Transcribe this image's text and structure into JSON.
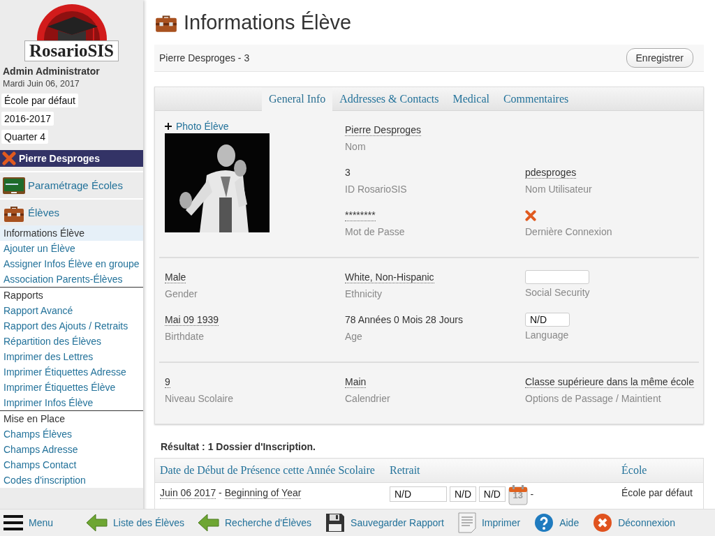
{
  "sidebar": {
    "logo": "RosarioSIS",
    "user": "Admin Administrator",
    "date": "Mardi Juin 06, 2017",
    "selectors": [
      "École par défaut",
      "2016-2017",
      "Quarter 4"
    ],
    "current_student": "Pierre Desproges",
    "modules": [
      {
        "label": "Paramétrage Écoles"
      },
      {
        "label": "Élèves",
        "items": [
          {
            "kind": "link",
            "label": "Informations Élève",
            "selected": true
          },
          {
            "kind": "link",
            "label": "Ajouter un Élève",
            "selected": false
          },
          {
            "kind": "link",
            "label": "Assigner Infos Élève en groupe",
            "selected": false
          },
          {
            "kind": "link",
            "label": "Association Parents-Élèves",
            "selected": false
          },
          {
            "kind": "header",
            "label": "Rapports"
          },
          {
            "kind": "link",
            "label": "Rapport Avancé",
            "selected": false
          },
          {
            "kind": "link",
            "label": "Rapport des Ajouts / Retraits",
            "selected": false
          },
          {
            "kind": "link",
            "label": "Répartition des Élèves",
            "selected": false
          },
          {
            "kind": "link",
            "label": "Imprimer des Lettres",
            "selected": false
          },
          {
            "kind": "link",
            "label": "Imprimer Étiquettes Adresse",
            "selected": false
          },
          {
            "kind": "link",
            "label": "Imprimer Étiquettes Élève",
            "selected": false
          },
          {
            "kind": "link",
            "label": "Imprimer Infos Élève",
            "selected": false
          },
          {
            "kind": "header",
            "label": "Mise en Place"
          },
          {
            "kind": "link",
            "label": "Champs Élèves",
            "selected": false
          },
          {
            "kind": "link",
            "label": "Champs Adresse",
            "selected": false
          },
          {
            "kind": "link",
            "label": "Champs Contact",
            "selected": false
          },
          {
            "kind": "link",
            "label": "Codes d'inscription",
            "selected": false
          }
        ]
      }
    ]
  },
  "page": {
    "title": "Informations Élève",
    "header": "Pierre Desproges - 3",
    "save_button": "Enregistrer"
  },
  "tabs": [
    {
      "label": "General Info",
      "selected": true
    },
    {
      "label": "Addresses & Contacts",
      "selected": false
    },
    {
      "label": "Medical",
      "selected": false
    },
    {
      "label": "Commentaires",
      "selected": false
    }
  ],
  "general": {
    "photo_link": "Photo Élève",
    "sections": [
      {
        "rows": [
          [
            {
              "kind": "text",
              "value": "Pierre Desproges",
              "label": "Nom"
            }
          ],
          [
            {
              "kind": "plain",
              "value": "3",
              "label": "ID RosarioSIS"
            },
            {
              "kind": "text",
              "value": "pdesproges",
              "label": "Nom Utilisateur"
            }
          ],
          [
            {
              "kind": "text",
              "value": "********",
              "label": "Mot de Passe"
            },
            {
              "kind": "icon",
              "label": "Dernière Connexion"
            }
          ]
        ]
      },
      {
        "rows": [
          [
            {
              "kind": "text",
              "value": "Male",
              "label": "Gender"
            },
            {
              "kind": "text",
              "value": "White, Non-Hispanic",
              "label": "Ethnicity"
            },
            {
              "kind": "input",
              "label": "Social Security"
            }
          ],
          [
            {
              "kind": "text",
              "value": "Mai 09 1939",
              "label": "Birthdate"
            },
            {
              "kind": "plain",
              "value": "78 Années 0 Mois 28 Jours",
              "label": "Age"
            },
            {
              "kind": "input",
              "value": "N/D",
              "label": "Language"
            }
          ]
        ]
      },
      {
        "rows": [
          [
            {
              "kind": "text",
              "value": "9",
              "label": "Niveau Scolaire"
            },
            {
              "kind": "text",
              "value": "Main",
              "label": "Calendrier"
            },
            {
              "kind": "text",
              "value": "Classe supérieure dans la même école",
              "label": "Options de Passage / Maintient"
            }
          ]
        ]
      }
    ]
  },
  "enrollment": {
    "result": "Résultat : 1 Dossier d'Inscription.",
    "columns": [
      "Date de Début de Présence cette Année Scolaire",
      "Retrait",
      "École"
    ],
    "rows": [
      {
        "start_date": "Juin 06 2017",
        "separator": "-",
        "start_type": "Beginning of Year",
        "drop_inputs": [
          "N/D",
          "N/D",
          "N/D"
        ],
        "calendar_day": "13",
        "drop_separator": "-",
        "school": "École par défaut"
      }
    ]
  },
  "bottom_bar": [
    {
      "label": "Menu"
    },
    {
      "label": "Liste des Élèves"
    },
    {
      "label": "Recherche d'Élèves"
    },
    {
      "label": "Sauvegarder Rapport"
    },
    {
      "label": "Imprimer"
    },
    {
      "label": "Aide"
    },
    {
      "label": "Déconnexion"
    }
  ]
}
